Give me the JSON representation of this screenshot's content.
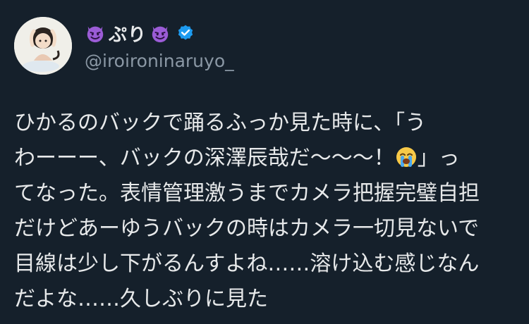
{
  "author": {
    "display_name": "ぷり",
    "handle": "@iroironinaruyo_",
    "verified": true,
    "name_emoji": "smiling-devil-emoji"
  },
  "tweet": {
    "lines": [
      "ひかるのバックで踊るふっか見た時に、「う",
      "わーーー、バックの深澤辰哉だ〜〜〜！",
      "」っ",
      "てなった。表情管理激うまでカメラ把握完璧自担",
      "だけどあーゆうバックの時はカメラ一切見ないで",
      "目線は少し下がるんすよね……溶け込む感じなん",
      "だよな……久しぶりに見た"
    ],
    "inline_emoji": "loudly-crying-face-emoji"
  },
  "colors": {
    "background": "#15202b",
    "text": "#e7e9ea",
    "secondary": "#8b98a5",
    "verified": "#1d9bf0"
  }
}
